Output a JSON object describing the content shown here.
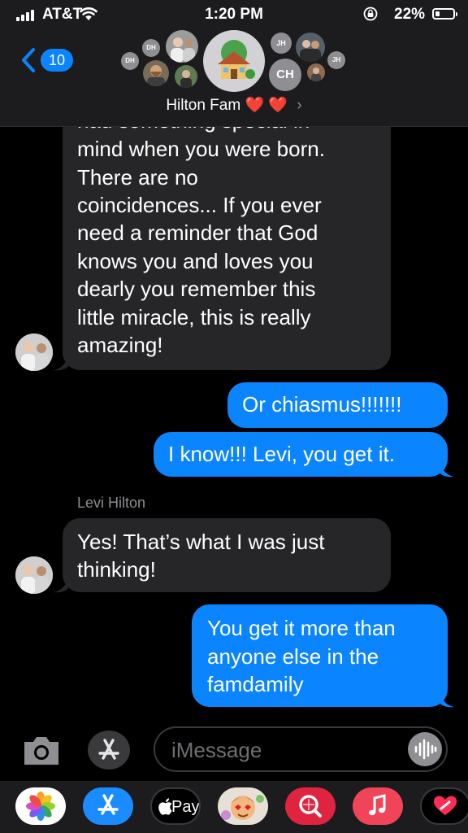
{
  "status_bar": {
    "carrier": "AT&T",
    "time": "1:20 PM",
    "battery_percent": "22%"
  },
  "header": {
    "back_badge": "10",
    "group_name": "Hilton Fam",
    "title_emoji": "❤️ ❤️",
    "chevron": "›",
    "group_icon": "house-tree-icon",
    "member_initials": [
      "DH",
      "DH",
      "JH",
      "CH",
      "JH"
    ]
  },
  "messages": [
    {
      "direction": "received",
      "text": "had something special in mind when you were born. There are no coincidences... If you ever need a reminder that God knows you and loves you dearly you remember this little miracle, this is really amazing!"
    },
    {
      "direction": "sent",
      "text": "Or chiasmus!!!!!!!"
    },
    {
      "direction": "sent",
      "text": "I know!!! Levi, you get it."
    },
    {
      "direction": "received",
      "sender": "Levi Hilton",
      "text": "Yes!  That’s what I was just thinking!"
    },
    {
      "direction": "sent",
      "text": "You get it more than anyone else in the famdamily"
    }
  ],
  "received_1_lines": [
    "had something special in",
    "mind when you were born.",
    "There are no",
    "coincidences... If you ever",
    "need a reminder that God",
    "knows you and loves you",
    "dearly you remember this",
    "little miracle, this is really",
    "amazing!"
  ],
  "received_2_lines": [
    "Yes!  That’s what I was just",
    "thinking!"
  ],
  "sent_3_lines": [
    "You get it more than",
    "anyone else in the",
    "famdamily"
  ],
  "input": {
    "placeholder": "iMessage"
  },
  "app_drawer": {
    "apps": [
      "photos-app-icon",
      "app-store-icon",
      "apple-pay-icon",
      "memoji-icon",
      "web-images-search-icon",
      "music-app-icon",
      "digital-touch-icon"
    ],
    "apple_pay_label": "Pay"
  },
  "colors": {
    "accent": "#0a84ff",
    "received_bubble": "#262628",
    "header_bg": "#1c1c1e",
    "background": "#000000"
  }
}
